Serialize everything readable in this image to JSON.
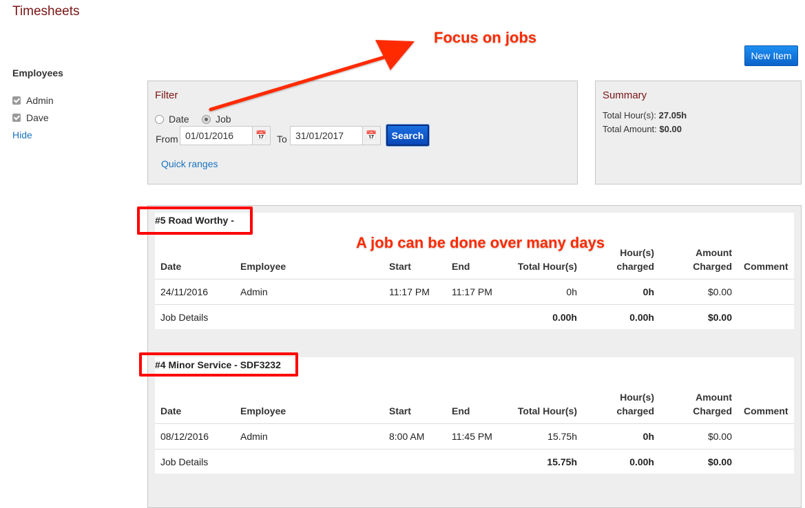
{
  "page": {
    "title": "Timesheets"
  },
  "employees": {
    "heading": "Employees",
    "items": [
      {
        "label": "Admin",
        "checked": true
      },
      {
        "label": "Dave",
        "checked": true
      }
    ],
    "hide_label": "Hide"
  },
  "toolbar": {
    "new_item_label": "New Item"
  },
  "filter": {
    "title": "Filter",
    "mode_options": [
      {
        "label": "Date",
        "selected": false
      },
      {
        "label": "Job",
        "selected": true
      }
    ],
    "from_label": "From",
    "from_value": "01/01/2016",
    "to_label": "To",
    "to_value": "31/01/2017",
    "search_label": "Search",
    "quick_ranges_label": "Quick ranges"
  },
  "summary": {
    "title": "Summary",
    "total_hours_label": "Total Hour(s):",
    "total_hours_value": "27.05h",
    "total_amount_label": "Total Amount:",
    "total_amount_value": "$0.00"
  },
  "table_headers": {
    "date": "Date",
    "employee": "Employee",
    "start": "Start",
    "end": "End",
    "total_hours": "Total Hour(s)",
    "hours_charged_1": "Hour(s)",
    "hours_charged_2": "charged",
    "amount_charged_1": "Amount",
    "amount_charged_2": "Charged",
    "comment": "Comment"
  },
  "jobs": [
    {
      "title": "#5 Road Worthy -",
      "rows": [
        {
          "date": "24/11/2016",
          "employee": "Admin",
          "start": "11:17 PM",
          "end": "11:17 PM",
          "total_hours": "0h",
          "hours_charged": "0h",
          "amount_charged": "$0.00",
          "comment": ""
        }
      ],
      "details_label": "Job Details",
      "totals": {
        "total_hours": "0.00h",
        "hours_charged": "0.00h",
        "amount_charged": "$0.00"
      }
    },
    {
      "title": "#4 Minor Service - SDF3232",
      "rows": [
        {
          "date": "08/12/2016",
          "employee": "Admin",
          "start": "8:00 AM",
          "end": "11:45 PM",
          "total_hours": "15.75h",
          "hours_charged": "0h",
          "amount_charged": "$0.00",
          "comment": ""
        }
      ],
      "details_label": "Job Details",
      "totals": {
        "total_hours": "15.75h",
        "hours_charged": "0.00h",
        "amount_charged": "$0.00"
      }
    }
  ],
  "annotations": {
    "focus_jobs": "Focus on jobs",
    "many_days": "A job can be done over many days",
    "color": "#ff2a00"
  },
  "colors": {
    "title_color": "#7a1414",
    "link_color": "#1a73c0",
    "primary_button": "#0a63c9",
    "panel_bg": "#eeeeee",
    "annotation_red": "#ff0000"
  }
}
